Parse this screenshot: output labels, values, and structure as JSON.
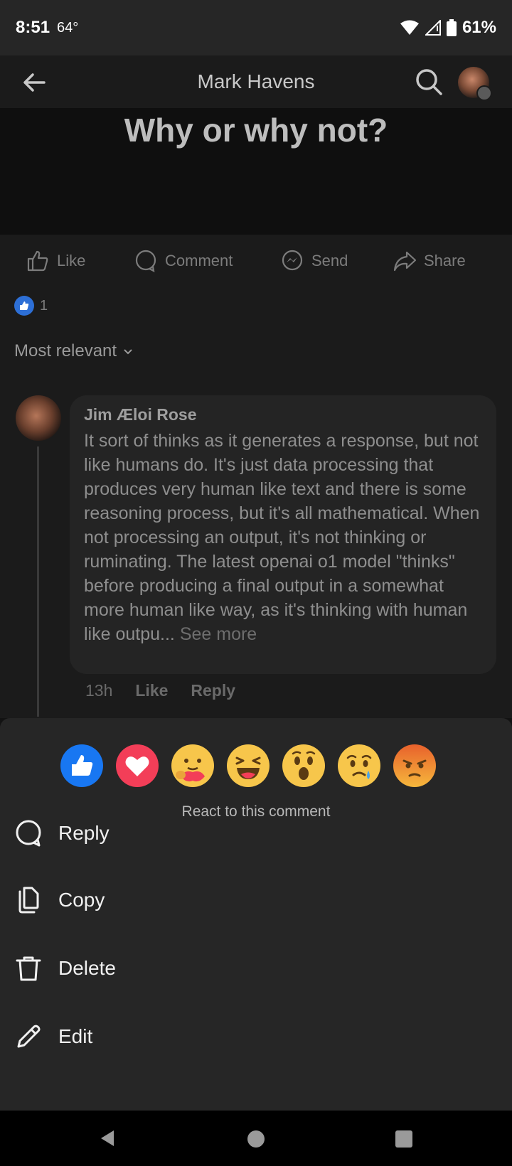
{
  "status": {
    "time": "8:51",
    "temp": "64°",
    "battery": "61%"
  },
  "header": {
    "title": "Mark Havens"
  },
  "post": {
    "question": "Why or why not?"
  },
  "actions": {
    "like": "Like",
    "comment": "Comment",
    "send": "Send",
    "share": "Share"
  },
  "reaction_count": "1",
  "sort_label": "Most relevant",
  "comment": {
    "author": "Jim Æloi Rose",
    "text": "It sort of thinks as it generates a response, but not like humans do. It's just data processing that produces very human like text and there is some reasoning process, but it's all mathematical. When not processing an output, it's not thinking or ruminating. The latest openai o1 model \"thinks\" before producing a final output in a somewhat more human like way, as it's thinking with human like outpu...",
    "see_more": "See more",
    "time": "13h",
    "like": "Like",
    "reply": "Reply"
  },
  "sheet": {
    "reactions": [
      "like-reaction-icon",
      "love-reaction-icon",
      "care-reaction-icon",
      "haha-reaction-icon",
      "wow-reaction-icon",
      "sad-reaction-icon",
      "angry-reaction-icon"
    ],
    "react_label": "React to this comment",
    "menu": {
      "reply": "Reply",
      "copy": "Copy",
      "delete": "Delete",
      "edit": "Edit"
    }
  },
  "colors": {
    "like_blue": "#1877f2",
    "love_red": "#f33e58",
    "emoji_yellow": "#f7c64b",
    "angry_orange": "#e8612c"
  }
}
